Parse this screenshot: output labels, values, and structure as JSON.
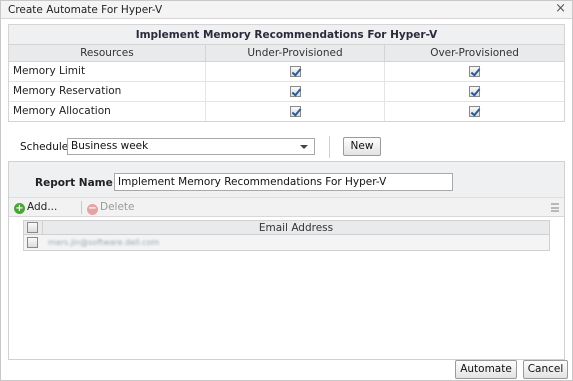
{
  "window": {
    "title": "Create Automate For Hyper-V",
    "close_label": "×"
  },
  "recommendations": {
    "header": "Implement Memory Recommendations For Hyper-V",
    "columns": [
      "Resources",
      "Under-Provisioned",
      "Over-Provisioned"
    ],
    "rows": [
      {
        "label": "Memory Limit",
        "under": true,
        "over": true
      },
      {
        "label": "Memory Reservation",
        "under": true,
        "over": true
      },
      {
        "label": "Memory Allocation",
        "under": true,
        "over": true
      }
    ]
  },
  "schedule": {
    "label": "Schedule",
    "value": "Business week",
    "new_button": "New"
  },
  "report": {
    "name_label": "Report Name",
    "name_value": "Implement Memory Recommendations For Hyper-V",
    "toolbar": {
      "add_label": "Add...",
      "delete_label": "Delete"
    },
    "email_header": "Email Address",
    "emails": [
      "mars.jin@software.dell.com"
    ]
  },
  "footer": {
    "automate_button": "Automate",
    "cancel_button": "Cancel"
  }
}
